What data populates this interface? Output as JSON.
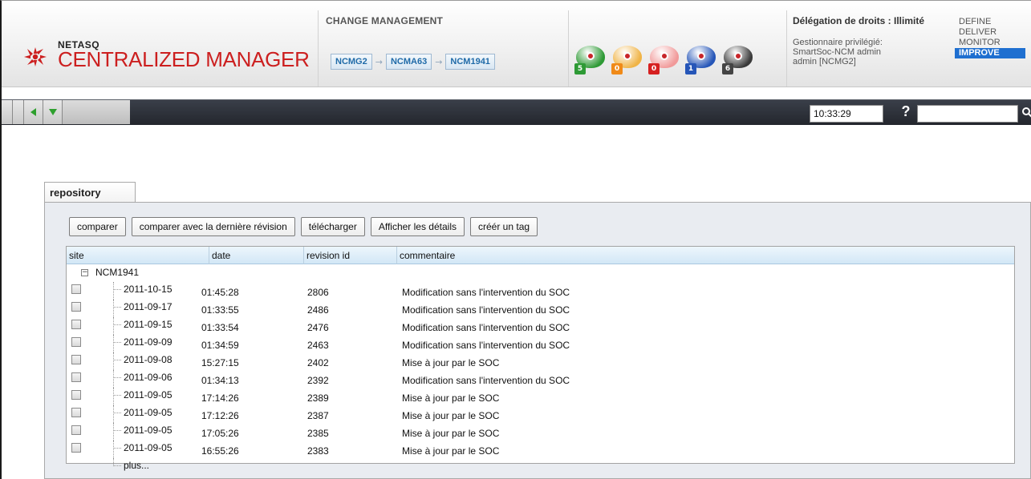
{
  "header": {
    "brand_small": "NETASQ",
    "brand_title": "CENTRALIZED MANAGER",
    "change_management": {
      "title": "CHANGE MANAGEMENT",
      "breadcrumbs": [
        "NCMG2",
        "NCMA63",
        "NCM1941"
      ]
    },
    "status_icons": [
      {
        "name": "ok",
        "count": "5",
        "color": "#2e9a35",
        "badge": "#2e9a35"
      },
      {
        "name": "warning",
        "count": "0",
        "color": "#f0b447",
        "badge": "#f08a18"
      },
      {
        "name": "critical",
        "count": "0",
        "color": "#f19a9a",
        "badge": "#d62020"
      },
      {
        "name": "info",
        "count": "1",
        "color": "#2656b8",
        "badge": "#2656b8"
      },
      {
        "name": "unknown",
        "count": "6",
        "color": "#3a3a3a",
        "badge": "#444444"
      }
    ],
    "delegation": {
      "title": "Délégation de droits : Illimité",
      "lines": [
        "Gestionnaire privilégié:",
        "SmartSoc-NCM admin",
        "admin [NCMG2]"
      ]
    },
    "menu": [
      {
        "label": "DEFINE",
        "active": false
      },
      {
        "label": "DELIVER",
        "active": false
      },
      {
        "label": "MONITOR",
        "active": false
      },
      {
        "label": "IMPROVE",
        "active": true
      }
    ]
  },
  "toolbar": {
    "clock": "10:33:29",
    "help_label": "?",
    "search_value": ""
  },
  "panel": {
    "tab_label": "repository",
    "actions": [
      "comparer",
      "comparer avec la dernière révision",
      "télécharger",
      "Afficher les détails",
      "créér un tag"
    ],
    "columns": [
      "site",
      "date",
      "revision id",
      "commentaire"
    ],
    "root_label": "NCM1941",
    "toggle_symbol": "−",
    "rows": [
      {
        "site": "2011-10-15",
        "date": "01:45:28",
        "revision": "2806",
        "comment": "Modification sans l'intervention du SOC"
      },
      {
        "site": "2011-09-17",
        "date": "01:33:55",
        "revision": "2486",
        "comment": "Modification sans l'intervention du SOC"
      },
      {
        "site": "2011-09-15",
        "date": "01:33:54",
        "revision": "2476",
        "comment": "Modification sans l'intervention du SOC"
      },
      {
        "site": "2011-09-09",
        "date": "01:34:59",
        "revision": "2463",
        "comment": "Modification sans l'intervention du SOC"
      },
      {
        "site": "2011-09-08",
        "date": "15:27:15",
        "revision": "2402",
        "comment": "Mise à jour par le SOC"
      },
      {
        "site": "2011-09-06",
        "date": "01:34:13",
        "revision": "2392",
        "comment": "Modification sans l'intervention du SOC"
      },
      {
        "site": "2011-09-05",
        "date": "17:14:26",
        "revision": "2389",
        "comment": "Mise à jour par le SOC"
      },
      {
        "site": "2011-09-05",
        "date": "17:12:26",
        "revision": "2387",
        "comment": "Mise à jour par le SOC"
      },
      {
        "site": "2011-09-05",
        "date": "17:05:26",
        "revision": "2385",
        "comment": "Mise à jour par le SOC"
      },
      {
        "site": "2011-09-05",
        "date": "16:55:26",
        "revision": "2383",
        "comment": "Mise à jour par le SOC"
      }
    ],
    "more_label": "plus..."
  }
}
